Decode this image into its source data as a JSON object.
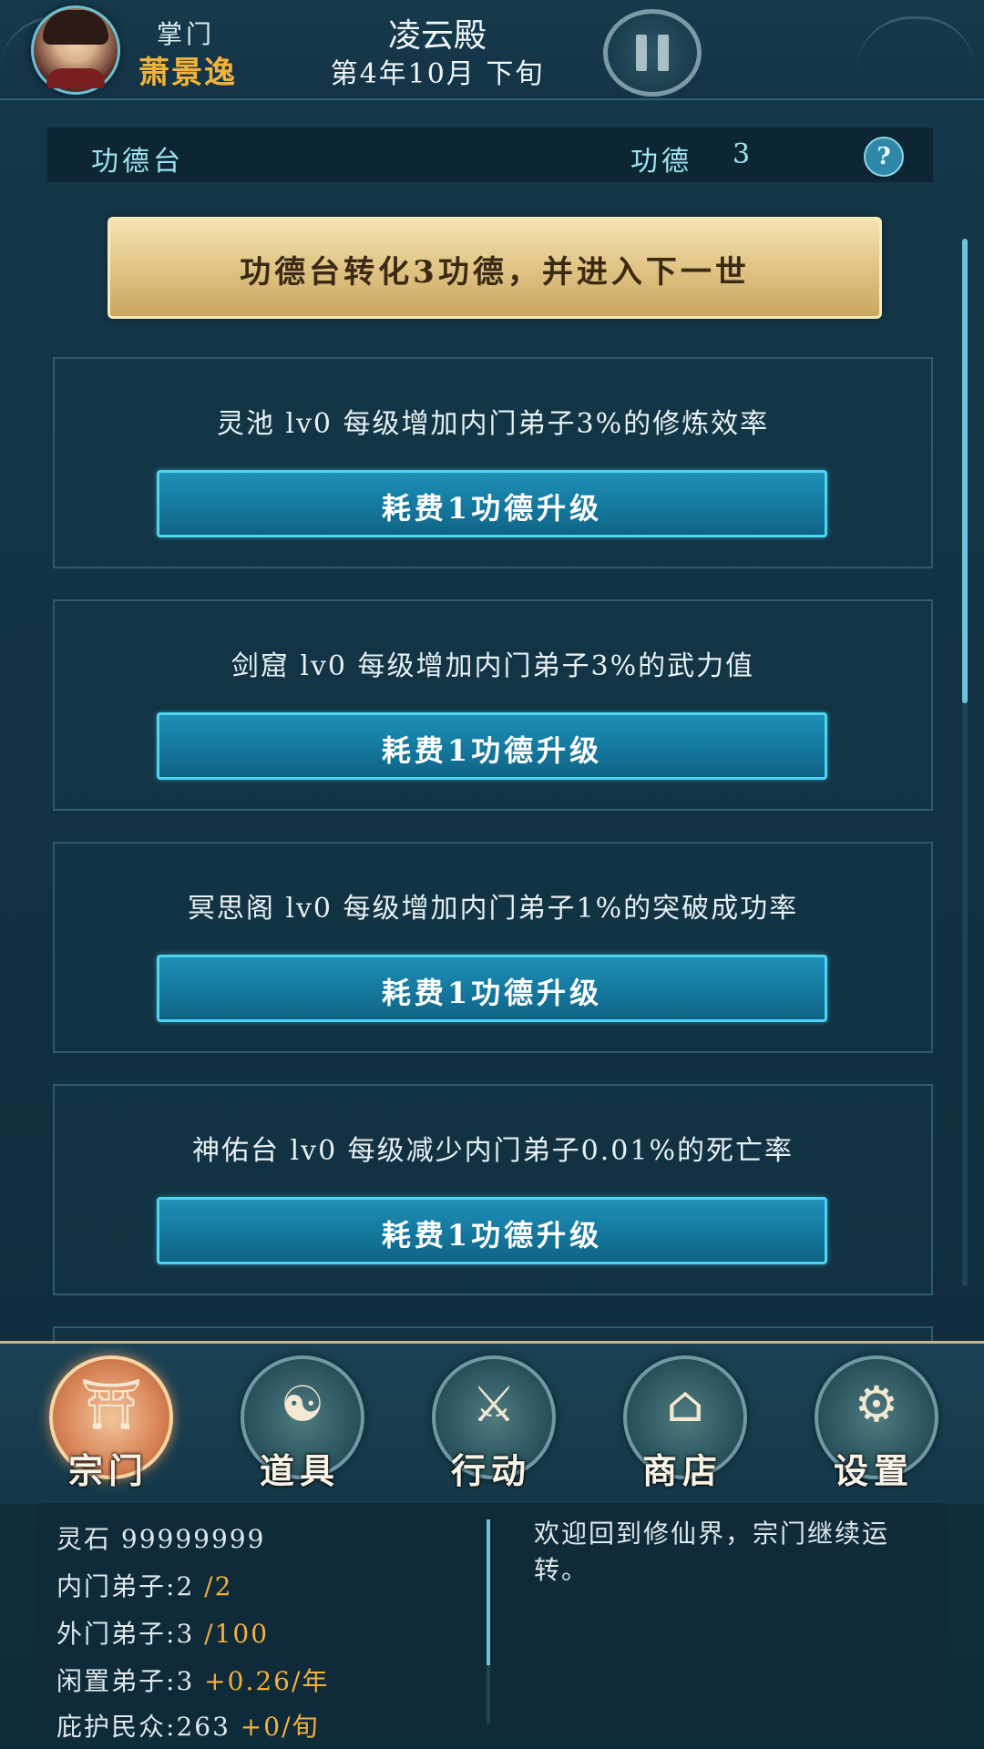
{
  "topbar": {
    "role_label": "掌门",
    "leader_name": "萧景逸",
    "sect_name": "凌云殿",
    "date": "第4年10月 下旬"
  },
  "header": {
    "title": "功德台",
    "merit_label": "功德",
    "merit_value": "3",
    "help_icon": "?"
  },
  "convert_button": {
    "label": "功德台转化3功德，并进入下一世"
  },
  "buildings": [
    {
      "description": "灵池 lv0 每级增加内门弟子3%的修炼效率",
      "button": "耗费1功德升级"
    },
    {
      "description": "剑窟 lv0 每级增加内门弟子3%的武力值",
      "button": "耗费1功德升级"
    },
    {
      "description": "冥思阁 lv0 每级增加内门弟子1%的突破成功率",
      "button": "耗费1功德升级"
    },
    {
      "description": "神佑台 lv0 每级减少内门弟子0.01%的死亡率",
      "button": "耗费1功德升级"
    }
  ],
  "nav": [
    {
      "label": "宗门",
      "icon": "sect-gate-icon",
      "glyph": "⛩",
      "active": true
    },
    {
      "label": "道具",
      "icon": "item-bag-icon",
      "glyph": "☯",
      "active": false
    },
    {
      "label": "行动",
      "icon": "action-sword-icon",
      "glyph": "⚔",
      "active": false
    },
    {
      "label": "商店",
      "icon": "shop-icon",
      "glyph": "⌂",
      "active": false
    },
    {
      "label": "设置",
      "icon": "gear-icon",
      "glyph": "⚙",
      "active": false
    }
  ],
  "status": {
    "spirit_stone_label": "灵石",
    "spirit_stone_value": "99999999",
    "inner_label": "内门弟子:",
    "inner_value": "2",
    "inner_max": "/2",
    "outer_label": "外门弟子:",
    "outer_value": "3",
    "outer_max": "/100",
    "idle_label": "闲置弟子:",
    "idle_value": "3",
    "idle_rate": "+0.26/年",
    "protect_label": "庇护民众:",
    "protect_value": "263",
    "protect_rate": "+0/旬"
  },
  "message": "欢迎回到修仙界，宗门继续运转。",
  "colors": {
    "accent_gold": "#f1b23c",
    "button_blue": "#157aa0",
    "button_border": "#4fd3f3"
  }
}
